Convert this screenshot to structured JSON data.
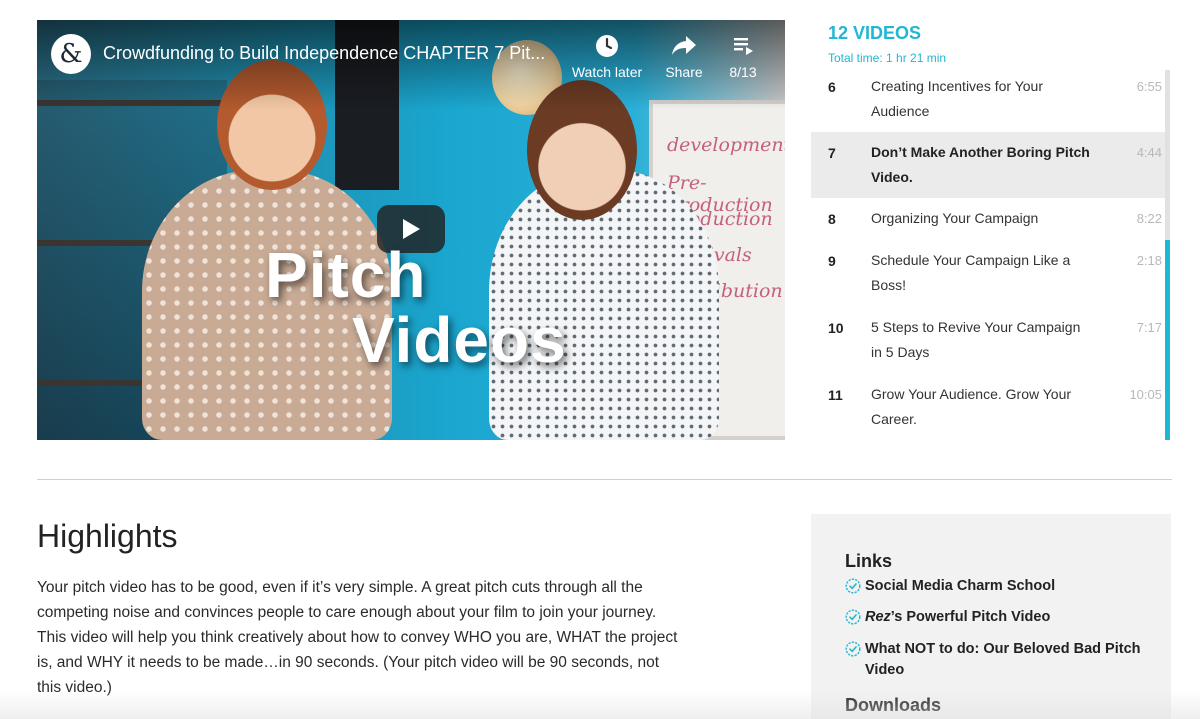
{
  "player": {
    "video_title": "Crowdfunding to Build Independence CHAPTER 7 Pit...",
    "channel_logo_glyph": "&",
    "actions": [
      {
        "label": "Watch later",
        "icon": "clock-icon"
      },
      {
        "label": "Share",
        "icon": "share-arrow-icon"
      },
      {
        "label": "8/13",
        "icon": "playlist-icon"
      }
    ],
    "title_card": [
      "Pitch",
      "Videos"
    ],
    "whiteboard_text": [
      "development",
      "Pre-Production",
      "Production",
      "Festivals",
      "Distribution"
    ],
    "play_icon": "play-icon"
  },
  "playlist": {
    "count": "12 VIDEOS",
    "total_time": "Total time: 1 hr 21 min",
    "items": [
      {
        "num": "6",
        "title": "Creating Incentives for Your Audience",
        "duration": "6:55",
        "active": false
      },
      {
        "num": "7",
        "title": "Don’t Make Another Boring Pitch Video.",
        "duration": "4:44",
        "active": true
      },
      {
        "num": "8",
        "title": "Organizing Your Campaign",
        "duration": "8:22",
        "active": false
      },
      {
        "num": "9",
        "title": "Schedule Your Campaign Like a Boss!",
        "duration": "2:18",
        "active": false
      },
      {
        "num": "10",
        "title": "5 Steps to Revive Your Campaign in 5 Days",
        "duration": "7:17",
        "active": false
      },
      {
        "num": "11",
        "title": "Grow Your Audience. Grow Your Career.",
        "duration": "10:05",
        "active": false
      }
    ]
  },
  "highlights": {
    "title": "Highlights",
    "body": "Your pitch video has to be good, even if it’s very simple. A great pitch cuts through all the competing noise and convinces people to care enough about your film to join your journey. This video will help you think creatively about how to convey WHO you are, WHAT the project is, and WHY it needs to be made…in 90 seconds. (Your pitch video will be 90 seconds, not this video.)"
  },
  "sidebar": {
    "links_heading": "Links",
    "links": [
      {
        "text": "Social Media Charm School",
        "icon": "check-badge-icon"
      },
      {
        "text_italic": "Rez",
        "text": "’s Powerful Pitch Video",
        "icon": "check-badge-icon"
      },
      {
        "text": "What NOT to do: Our Beloved Bad Pitch Video",
        "icon": "check-badge-icon"
      }
    ],
    "downloads_heading": "Downloads"
  },
  "colors": {
    "accent": "#1fb7d5",
    "active_row": "#ebebeb",
    "sidebar_bg": "#f2f2f2"
  }
}
